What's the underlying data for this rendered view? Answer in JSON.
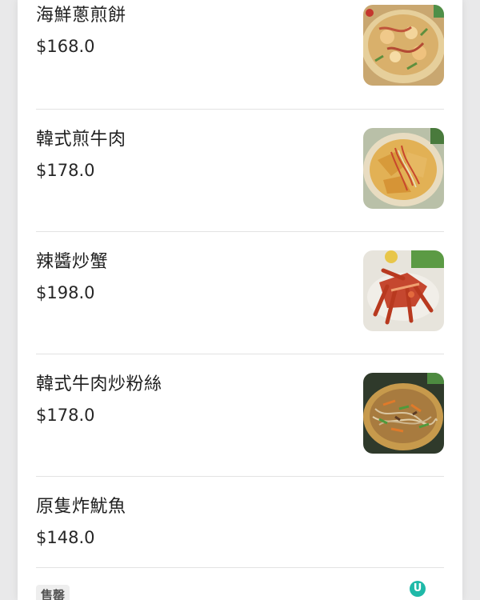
{
  "menu": {
    "items": [
      {
        "name": "海鮮蔥煎餅",
        "price": "$168.0",
        "image": "seafood-pancake-image"
      },
      {
        "name": "韓式煎牛肉",
        "price": "$178.0",
        "image": "korean-pan-fried-beef-image"
      },
      {
        "name": "辣醬炒蟹",
        "price": "$198.0",
        "image": "spicy-crab-image"
      },
      {
        "name": "韓式牛肉炒粉絲",
        "price": "$178.0",
        "image": "japchae-image"
      },
      {
        "name": "原隻炸魷魚",
        "price": "$148.0"
      }
    ],
    "sold_out_badge": "售罄"
  },
  "watermark": {
    "letter": "U"
  },
  "colors": {
    "background": "#e9e9ea",
    "panel": "#ffffff",
    "divider": "#e3e3e3",
    "badge_bg": "#eeeeee",
    "watermark": "#1fb9a8"
  }
}
